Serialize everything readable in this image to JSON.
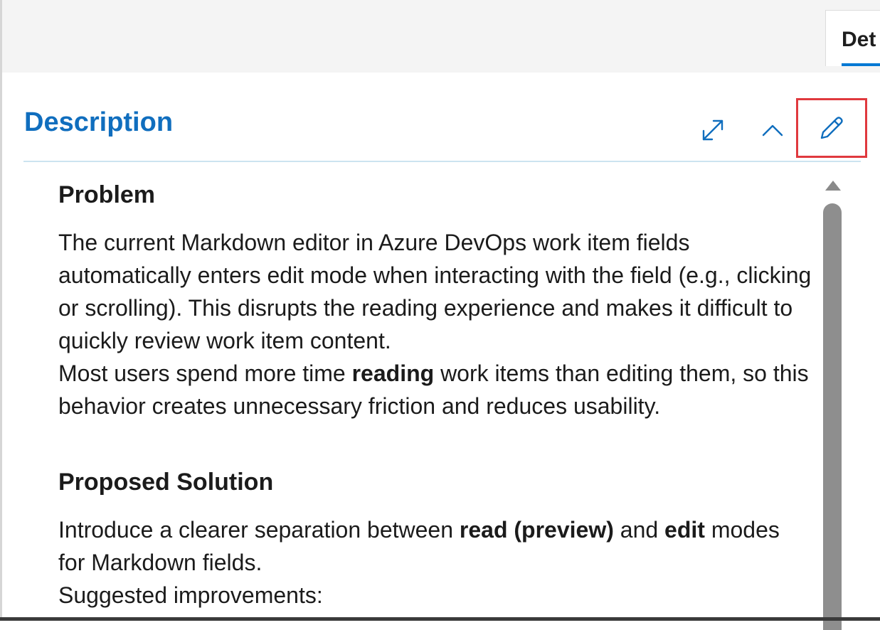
{
  "tab": {
    "label": "Det"
  },
  "section": {
    "title": "Description",
    "buttons": {
      "expand_icon": "expand-icon",
      "collapse_icon": "chevron-up-icon",
      "edit_icon": "pencil-icon"
    }
  },
  "content": {
    "problem": {
      "heading": "Problem",
      "line1": "The current Markdown editor in Azure DevOps work item fields automatically enters edit mode when interacting with the field (e.g., clicking or scrolling). This disrupts the reading experience and makes it difficult to quickly review work item content.",
      "line2_pre": "Most users spend more time ",
      "line2_bold": "reading",
      "line2_post": " work items than editing them, so this behavior creates unnecessary friction and reduces usability."
    },
    "solution": {
      "heading": "Proposed Solution",
      "line1_pre": "Introduce a clearer separation between ",
      "line1_bold1": "read (preview)",
      "line1_mid": " and ",
      "line1_bold2": "edit",
      "line1_post": " modes for Markdown fields.",
      "line2": "Suggested improvements:"
    }
  },
  "colors": {
    "accent": "#106ebe",
    "highlight_border": "#e0393e",
    "divider": "#cce4f0",
    "scrollbar": "#8e8e8e"
  }
}
